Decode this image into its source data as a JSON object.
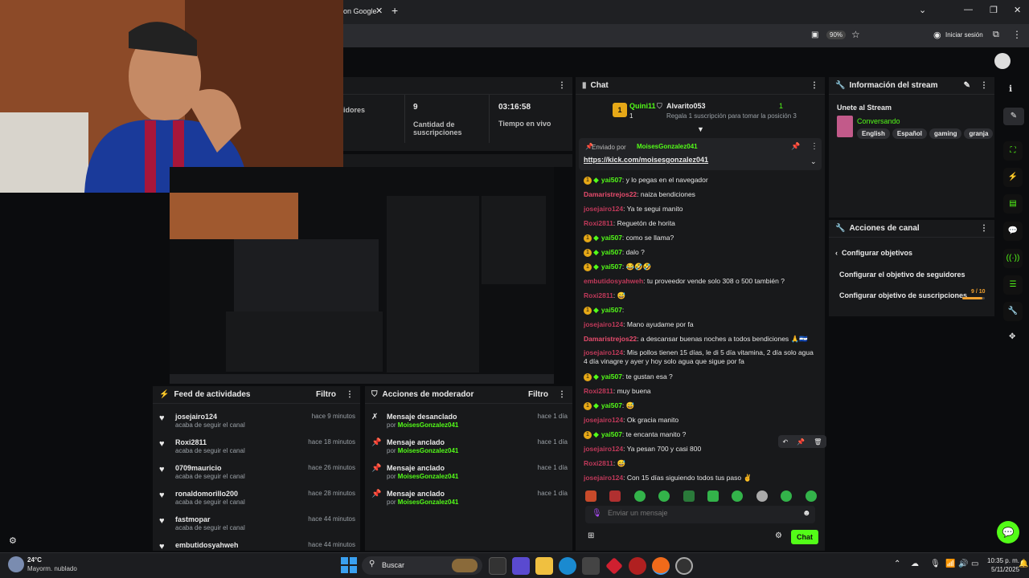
{
  "browser": {
    "tab_title": "on Google",
    "zoom": "90%",
    "signin": "Iniciar sesión"
  },
  "stats": [
    {
      "value": "",
      "label": "idores"
    },
    {
      "value": "9",
      "label": "Cantidad de suscripciones"
    },
    {
      "value": "03:16:58",
      "label": "Tiempo en vivo"
    }
  ],
  "chat": {
    "title": "Chat",
    "top_users": [
      {
        "name": "Quini11",
        "count": "1"
      },
      {
        "name": "Alvarito053",
        "count": "1"
      }
    ],
    "gift_note": "Regala 1 suscripción para tomar la posición 3",
    "pinned": {
      "sent_by_label": "Enviado por",
      "sent_by": "MoisesGonzalez041",
      "link": "https://kick.com/moisesgonzalez041"
    },
    "messages": [
      {
        "user": "yai507",
        "text": ": y lo pegas en el navegador",
        "color": "#53fc18",
        "badges": true
      },
      {
        "user": "Damaristrejos22",
        "text": ": naiza bendiciones",
        "color": "#e84c6d",
        "badges": false
      },
      {
        "user": "josejairo124",
        "text": ": Ya te segui manito",
        "color": "#c0395a",
        "badges": false
      },
      {
        "user": "Roxi2811",
        "text": ": Reguetón de horita",
        "color": "#c0395a",
        "badges": false
      },
      {
        "user": "yai507",
        "text": ": como se llama?",
        "color": "#53fc18",
        "badges": true
      },
      {
        "user": "yai507",
        "text": ": dalo ?",
        "color": "#53fc18",
        "badges": true
      },
      {
        "user": "yai507",
        "text": ": 😂🤣🤣",
        "color": "#53fc18",
        "badges": true
      },
      {
        "user": "embutidosyahweh",
        "text": ": tu proveedor vende solo 308 o 500 también ?",
        "color": "#c0395a",
        "badges": false
      },
      {
        "user": "Roxi2811",
        "text": ": 😅",
        "color": "#c0395a",
        "badges": false
      },
      {
        "user": "yai507",
        "text": ":",
        "color": "#53fc18",
        "badges": true
      },
      {
        "user": "josejairo124",
        "text": ": Mano ayudame por fa",
        "color": "#c0395a",
        "badges": false
      },
      {
        "user": "Damaristrejos22",
        "text": ": a descansar buenas noches a todos bendiciones 🙏🇸🇻",
        "color": "#e84c6d",
        "badges": false
      },
      {
        "user": "josejairo124",
        "text": ": Mis pollos tienen 15 días, le di 5 día vitamina, 2 día solo agua 4 día vinagre y ayer y hoy solo agua que sigue por fa",
        "color": "#c0395a",
        "badges": false
      },
      {
        "user": "yai507",
        "text": ": te gustan esa ?",
        "color": "#53fc18",
        "badges": true
      },
      {
        "user": "Roxi2811",
        "text": ": muy buena",
        "color": "#c0395a",
        "badges": false
      },
      {
        "user": "yai507",
        "text": ": 😅",
        "color": "#53fc18",
        "badges": true
      },
      {
        "user": "josejairo124",
        "text": ": Ok gracia manito",
        "color": "#c0395a",
        "badges": false
      },
      {
        "user": "yai507",
        "text": ": te encanta manito ?",
        "color": "#53fc18",
        "badges": true
      },
      {
        "user": "josejairo124",
        "text": ": Ya pesan 700 y casi 800",
        "color": "#c0395a",
        "badges": false
      },
      {
        "user": "Roxi2811",
        "text": ": 😅",
        "color": "#c0395a",
        "badges": false
      },
      {
        "user": "josejairo124",
        "text": ": Con 15 días siguiendo todos tus paso ✌️",
        "color": "#c0395a",
        "badges": false
      }
    ],
    "input_placeholder": "Enviar un mensaje",
    "send_label": "Chat"
  },
  "stream_info": {
    "title": "Información del stream",
    "stream_title": "Unete al Stream",
    "category": "Conversando",
    "tags": [
      "English",
      "Español",
      "gaming",
      "granja"
    ]
  },
  "channel_actions": {
    "title": "Acciones de canal",
    "subtitle": "Configurar objetivos",
    "item1": "Configurar el objetivo de seguidores",
    "item2": "Configurar objetivo de suscripciones",
    "progress": "9 / 10",
    "progress_value": 0.9
  },
  "feed": {
    "title": "Feed de actividades",
    "filter": "Filtro",
    "items": [
      {
        "name": "josejairo124",
        "sub": "acaba de seguir el canal",
        "time": "hace 9 minutos"
      },
      {
        "name": "Roxi2811",
        "sub": "acaba de seguir el canal",
        "time": "hace 18 minutos"
      },
      {
        "name": "0709mauricio",
        "sub": "acaba de seguir el canal",
        "time": "hace 26 minutos"
      },
      {
        "name": "ronaldomorillo200",
        "sub": "acaba de seguir el canal",
        "time": "hace 28 minutos"
      },
      {
        "name": "fastmopar",
        "sub": "acaba de seguir el canal",
        "time": "hace 44 minutos"
      },
      {
        "name": "embutidosyahweh",
        "sub": "",
        "time": "hace 44 minutos"
      }
    ]
  },
  "mod": {
    "title": "Acciones de moderador",
    "filter": "Filtro",
    "by": "por",
    "items": [
      {
        "name": "Mensaje desanclado",
        "by": "MoisesGonzalez041",
        "time": "hace 1 día"
      },
      {
        "name": "Mensaje anclado",
        "by": "MoisesGonzalez041",
        "time": "hace 1 día"
      },
      {
        "name": "Mensaje anclado",
        "by": "MoisesGonzalez041",
        "time": "hace 1 día"
      },
      {
        "name": "Mensaje anclado",
        "by": "MoisesGonzalez041",
        "time": "hace 1 día"
      }
    ]
  },
  "taskbar": {
    "weather_temp": "24°C",
    "weather_desc": "Mayorm. nublado",
    "search": "Buscar",
    "time": "10:35 p. m.",
    "date": "5/11/2025"
  }
}
